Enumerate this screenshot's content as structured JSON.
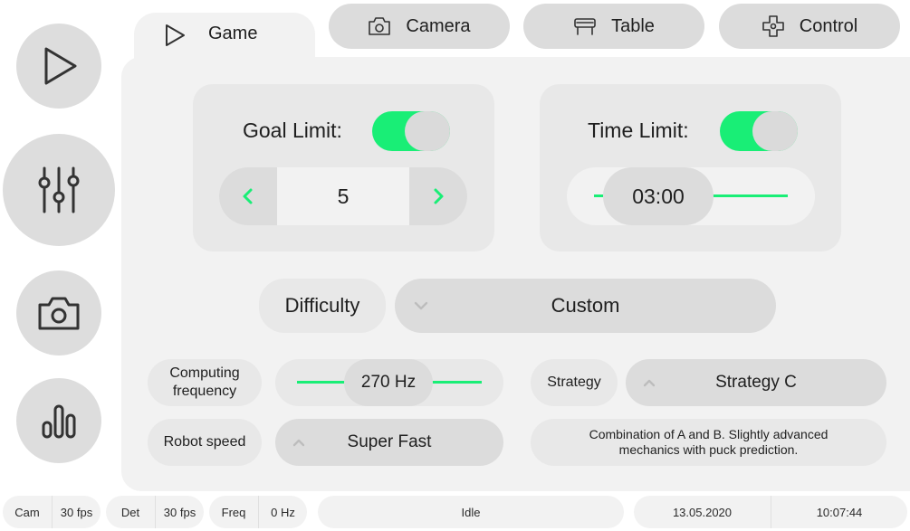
{
  "sidebar": {
    "items": [
      {
        "name": "play",
        "icon": "play-icon"
      },
      {
        "name": "sliders",
        "icon": "sliders-icon"
      },
      {
        "name": "camera",
        "icon": "camera-icon"
      },
      {
        "name": "stats",
        "icon": "bar-chart-icon"
      }
    ]
  },
  "tabs": {
    "game": "Game",
    "camera": "Camera",
    "table": "Table",
    "control": "Control"
  },
  "goal": {
    "label": "Goal Limit:",
    "enabled": true,
    "value": "5"
  },
  "time": {
    "label": "Time Limit:",
    "enabled": true,
    "value": "03:00"
  },
  "difficulty": {
    "label": "Difficulty",
    "value": "Custom"
  },
  "frequency": {
    "label": "Computing frequency",
    "value": "270 Hz"
  },
  "strategy": {
    "label": "Strategy",
    "value": "Strategy C",
    "description": "Combination of A and B. Slightly advanced mechanics with puck prediction."
  },
  "robot_speed": {
    "label": "Robot speed",
    "value": "Super Fast"
  },
  "status": {
    "cam_label": "Cam",
    "cam_value": "30 fps",
    "det_label": "Det",
    "det_value": "30 fps",
    "freq_label": "Freq",
    "freq_value": "0 Hz",
    "state": "Idle",
    "date": "13.05.2020",
    "time": "10:07:44"
  },
  "colors": {
    "accent": "#19ee76",
    "panel": "#f2f2f2",
    "control": "#dcdcdc"
  }
}
